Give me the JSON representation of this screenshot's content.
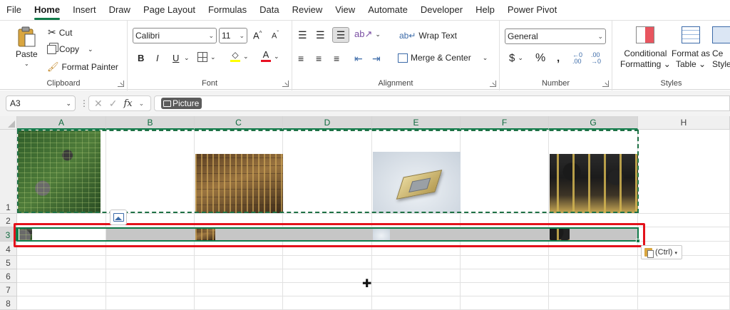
{
  "menu": [
    {
      "label": "File",
      "active": false
    },
    {
      "label": "Home",
      "active": true
    },
    {
      "label": "Insert",
      "active": false
    },
    {
      "label": "Draw",
      "active": false
    },
    {
      "label": "Page Layout",
      "active": false
    },
    {
      "label": "Formulas",
      "active": false
    },
    {
      "label": "Data",
      "active": false
    },
    {
      "label": "Review",
      "active": false
    },
    {
      "label": "View",
      "active": false
    },
    {
      "label": "Automate",
      "active": false
    },
    {
      "label": "Developer",
      "active": false
    },
    {
      "label": "Help",
      "active": false
    },
    {
      "label": "Power Pivot",
      "active": false
    }
  ],
  "ribbon": {
    "clipboard": {
      "label": "Clipboard",
      "paste": "Paste",
      "cut": "Cut",
      "copy": "Copy",
      "format_painter": "Format Painter"
    },
    "font": {
      "label": "Font",
      "name": "Calibri",
      "size": "11"
    },
    "alignment": {
      "label": "Alignment",
      "wrap_text": "Wrap Text",
      "merge_center": "Merge & Center"
    },
    "number": {
      "label": "Number",
      "format": "General"
    },
    "styles": {
      "label": "Styles",
      "conditional": "Conditional",
      "formatting": "Formatting",
      "format_as": "Format as",
      "table": "Table",
      "cell": "Ce",
      "styles": "Style"
    }
  },
  "formula_bar": {
    "name_box": "A3",
    "content_chip": "Picture"
  },
  "columns": [
    "A",
    "B",
    "C",
    "D",
    "E",
    "F",
    "G",
    "H"
  ],
  "selected_columns": [
    "A",
    "B",
    "C",
    "D",
    "E",
    "F",
    "G"
  ],
  "rows": [
    "1",
    "2",
    "3",
    "4",
    "5",
    "6",
    "7",
    "8"
  ],
  "selected_row": "3",
  "paste_options": "(Ctrl)",
  "colors": {
    "accent": "#117b4a",
    "highlight": "#e3121b"
  }
}
